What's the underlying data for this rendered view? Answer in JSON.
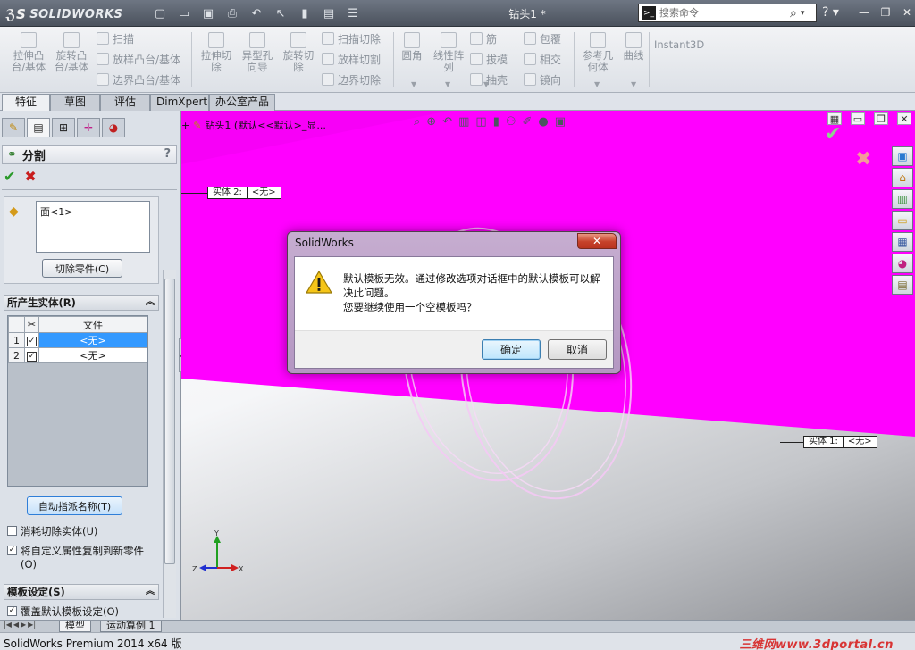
{
  "app": {
    "logo_text": "SOLIDWORKS",
    "doc_title": "钻头1 *",
    "search_placeholder": "搜索命令",
    "help": "?"
  },
  "ribbon": {
    "extrude_boss": "拉伸凸\n台/基体",
    "revolve_boss": "旋转凸\n台/基体",
    "sweep": "扫描",
    "loft_boss": "放样凸台/基体",
    "boundary_boss": "边界凸台/基体",
    "extrude_cut": "拉伸切\n除",
    "hole_wizard": "异型孔\n向导",
    "revolve_cut": "旋转切\n除",
    "sweep_cut": "扫描切除",
    "loft_cut": "放样切割",
    "boundary_cut": "边界切除",
    "fillet": "圆角",
    "linear_pattern": "线性阵\n列",
    "rib": "筋",
    "draft": "拔模",
    "shell": "抽壳",
    "wrap": "包覆",
    "intersect": "相交",
    "mirror": "镜向",
    "ref_geometry": "参考几\n何体",
    "curves": "曲线",
    "instant3d": "Instant3D"
  },
  "tabs": [
    "特征",
    "草图",
    "评估",
    "DimXpert",
    "办公室产品"
  ],
  "property_manager": {
    "title": "分割",
    "help": "?",
    "face_item": "面<1>",
    "cut_part_button": "切除零件(C)",
    "bodies_section": "所产生实体(R)",
    "table_header_file": "文件",
    "rows": [
      {
        "num": "1",
        "file": "<无>",
        "selected": true
      },
      {
        "num": "2",
        "file": "<无>",
        "selected": false
      }
    ],
    "auto_name_button": "自动指派名称(T)",
    "consume_cut_bodies": "消耗切除实体(U)",
    "copy_custom_props": "将自定义属性复制到新零件(O)",
    "template_section": "模板设定(S)",
    "override_template": "覆盖默认模板设定(O)"
  },
  "graphics": {
    "tree_node": "钻头1  (默认<<默认>_显...",
    "callout1": {
      "label": "实体 2:",
      "value": "<无>"
    },
    "callout2": {
      "label": "实体 1:",
      "value": "<无>"
    },
    "triad": {
      "x": "X",
      "y": "Y",
      "z": "Z"
    }
  },
  "dialog": {
    "title": "SolidWorks",
    "message_line1": "默认模板无效。通过修改选项对话框中的默认模板可以解决此问题。",
    "message_line2": "您要继续使用一个空模板吗？",
    "ok": "确定",
    "cancel": "取消"
  },
  "bottom_tabs": [
    "模型",
    "运动算例 1"
  ],
  "status": {
    "text": "SolidWorks Premium 2014 x64 版",
    "watermark": "三维网www.3dportal.cn"
  },
  "colors": {
    "model": "#ff00ff",
    "dialog_frame": "#b497c2",
    "ok_check": "#2b9a2b",
    "cancel_x": "#c81d1d"
  }
}
